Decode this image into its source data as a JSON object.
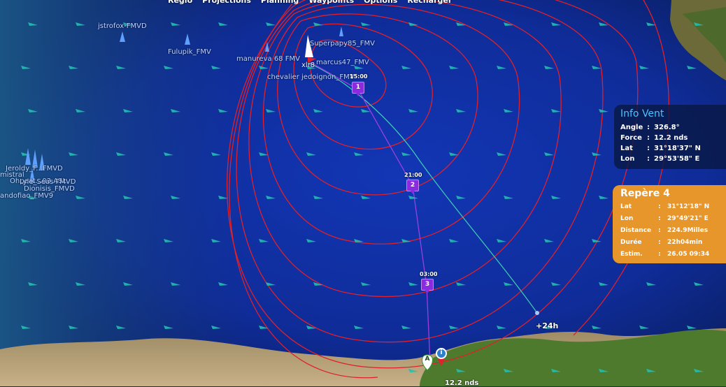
{
  "menu": [
    "Réglo",
    "Projections",
    "Planning",
    "Waypoints",
    "Options",
    "Recharger"
  ],
  "boats": [
    {
      "name": "jstrofox-FMVD"
    },
    {
      "name": "Fulupik_FMV"
    },
    {
      "name": "manureva 68 FMV"
    },
    {
      "name": "Superpapy85_FMV"
    },
    {
      "name": "marcus47_FMV"
    },
    {
      "name": "chevalier jedoignon_FMV"
    },
    {
      "name": "xlr8"
    },
    {
      "name": "Jeroldy_F...FMVD"
    },
    {
      "name": "mistral"
    },
    {
      "name": "Ohpeat...03 ASL"
    },
    {
      "name": "Lyle_Seas FMVD"
    },
    {
      "name": "Dionisis_FMVD"
    },
    {
      "name": "andofiao_FMV9"
    }
  ],
  "waypoints": [
    {
      "number": "1",
      "time": "15:00"
    },
    {
      "number": "2",
      "time": "21:00"
    },
    {
      "number": "3",
      "time": "03:00"
    }
  ],
  "forecast_label": "+24h",
  "speed_label": "12.2 nds",
  "start_marker": "A",
  "info_marker": "i",
  "wind_info": {
    "title": "Info Vent",
    "rows": [
      {
        "key": "Angle",
        "value": "326.8°"
      },
      {
        "key": "Force",
        "value": "12.2 nds"
      },
      {
        "key": "Lat",
        "value": "31°18'37\" N"
      },
      {
        "key": "Lon",
        "value": "29°53'58\" E"
      }
    ]
  },
  "repere": {
    "title": "Repère 4",
    "rows": [
      {
        "key": "Lat",
        "value": "31°12'18\" N"
      },
      {
        "key": "Lon",
        "value": "29°49'21\" E"
      },
      {
        "key": "Distance",
        "value": "224.9Milles"
      },
      {
        "key": "Durée",
        "value": "22h04min"
      },
      {
        "key": "Estim.",
        "value": "26.05 09:34"
      }
    ]
  },
  "colors": {
    "sea": "#1530a8",
    "isochrone": "#e0202a",
    "route": "#9b3fe0",
    "forecast_track": "#3fd0b0",
    "wind_arrow": "#21c0b0",
    "panel_wind": "#0a1946",
    "panel_repere": "#e6962b",
    "waypoint": "#8b2be0"
  }
}
